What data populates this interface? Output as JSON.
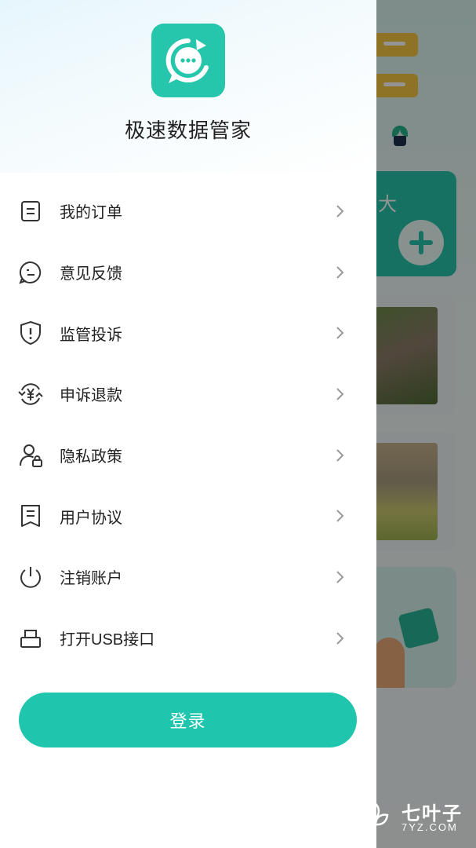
{
  "app": {
    "name": "极速数据管家",
    "logo_icon": "chat-bubble-refresh-icon",
    "accent_color": "#1fc5ad"
  },
  "menu": {
    "items": [
      {
        "label": "我的订单",
        "icon": "order-list-icon"
      },
      {
        "label": "意见反馈",
        "icon": "feedback-icon"
      },
      {
        "label": "监管投诉",
        "icon": "shield-alert-icon"
      },
      {
        "label": "申诉退款",
        "icon": "refund-yuan-icon"
      },
      {
        "label": "隐私政策",
        "icon": "user-lock-icon"
      },
      {
        "label": "用户协议",
        "icon": "agreement-icon"
      },
      {
        "label": "注销账户",
        "icon": "power-icon"
      },
      {
        "label": "打开USB接口",
        "icon": "usb-icon"
      }
    ],
    "arrow_icon": "chevron-right-icon"
  },
  "login": {
    "label": "登录"
  },
  "background": {
    "green_card_text": "大"
  },
  "watermark": {
    "name": "七叶子",
    "domain": "7YZ.COM"
  }
}
